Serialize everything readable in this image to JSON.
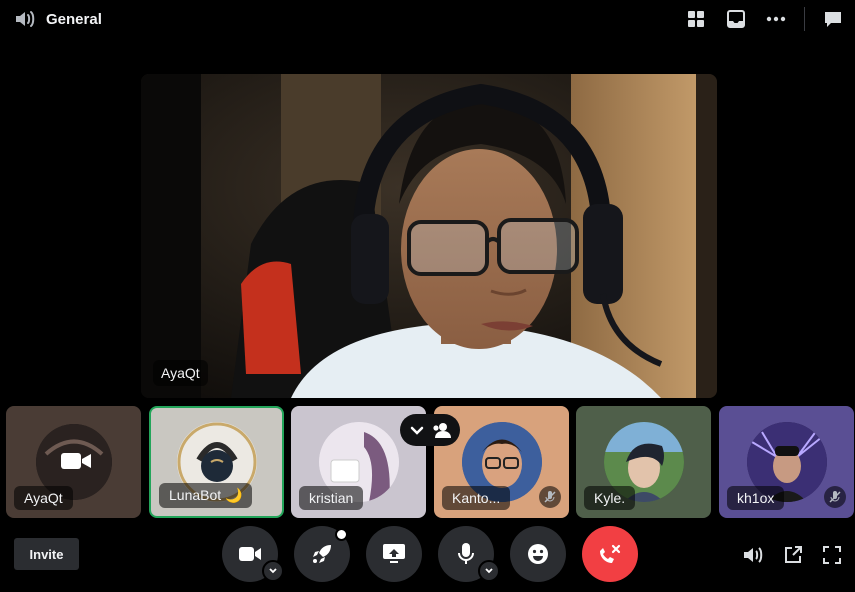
{
  "header": {
    "channel_icon": "speaker-icon",
    "channel_name": "General",
    "actions": [
      "grid-icon",
      "inbox-icon",
      "more-icon",
      "chat-icon"
    ]
  },
  "main_stream": {
    "user": "AyaQt"
  },
  "participants": [
    {
      "name": "AyaQt",
      "camera_on": true,
      "muted": false,
      "speaking": false,
      "background": "#4a3c35"
    },
    {
      "name": "LunaBot 🌙",
      "muted": false,
      "speaking": true,
      "background": "#c9c7c1"
    },
    {
      "name": "kristian",
      "muted": false,
      "speaking": false,
      "background": "#cac5cf"
    },
    {
      "name": "Kanto...",
      "muted": true,
      "speaking": false,
      "background": "#d8a27c"
    },
    {
      "name": "Kyle.",
      "muted": false,
      "speaking": false,
      "background": "#4f5f4a"
    },
    {
      "name": "kh1ox",
      "muted": true,
      "speaking": false,
      "background": "#5a4f94"
    }
  ],
  "strip_toggle": {
    "icons": [
      "chevron-down-icon",
      "people-icon"
    ]
  },
  "controls": {
    "invite_label": "Invite",
    "buttons": [
      "camera-icon",
      "activity-rocket-icon",
      "screen-share-icon",
      "microphone-icon",
      "emoji-icon",
      "disconnect-icon"
    ]
  },
  "bottom_right": [
    "volume-icon",
    "popout-icon",
    "fullscreen-icon"
  ],
  "colors": {
    "speaking_ring": "#23a55a",
    "disconnect": "#f23f43",
    "control_bg": "#2b2d31"
  }
}
